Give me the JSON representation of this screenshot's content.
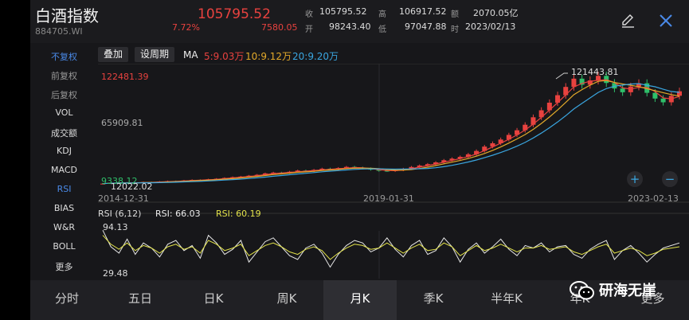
{
  "header": {
    "name": "白酒指数",
    "code": "884705.WI",
    "price": "105795.52",
    "pct": "7.72%",
    "change": "7580.05",
    "quotes": [
      {
        "label": "收",
        "value": "105795.52"
      },
      {
        "label": "高",
        "value": "106917.52"
      },
      {
        "label": "额",
        "value": "2070.05亿"
      },
      {
        "label": "开",
        "value": "98243.40"
      },
      {
        "label": "低",
        "value": "97047.88"
      },
      {
        "label": "时",
        "value": "2023/02/13"
      }
    ]
  },
  "sidebar": {
    "items": [
      "不复权",
      "前复权",
      "后复权",
      "VOL",
      "成交额",
      "KDJ",
      "MACD",
      "RSI",
      "BIAS",
      "W&R",
      "BOLL",
      "更多"
    ]
  },
  "toolbar": {
    "overlay": "叠加",
    "period": "设周期",
    "ma_label": "MA",
    "ma5": "5:9.03万",
    "ma10": "10:9.12万",
    "ma20": "20:9.20万"
  },
  "kline": {
    "high_label": "122481.39",
    "mid_label": "65909.81",
    "low_label": "9338.12",
    "min_label": "12022.02",
    "peak_label": "121443.81",
    "date_start": "2014-12-31",
    "date_mid": "2019-01-31",
    "date_end": "2023-02-13",
    "zoom_in": "+",
    "zoom_out": "−"
  },
  "rsi": {
    "title": "RSI (6,12)",
    "r1": "RSI: 66.03",
    "r2": "RSI: 60.19",
    "top": "94.13",
    "bottom": "29.48"
  },
  "tabs": [
    "分时",
    "五日",
    "日K",
    "周K",
    "月K",
    "季K",
    "半年K",
    "年K",
    "更多"
  ],
  "selected_tab": "月K",
  "watermark": "研海无崖",
  "colors": {
    "up": "#e8423f",
    "down": "#2fbf6a",
    "ma5": "#e8423f",
    "ma10": "#e3a92a",
    "ma20": "#3aa6e0",
    "accent": "#4a8ae8"
  },
  "chart_data": {
    "type": "candlestick",
    "title": "",
    "ylim": [
      9338.12,
      122481.39
    ],
    "close_series": [
      12022,
      12800,
      13200,
      12500,
      13000,
      13600,
      13400,
      14100,
      14600,
      14300,
      15200,
      15800,
      15500,
      16400,
      17000,
      17800,
      18600,
      19200,
      20100,
      21000,
      22400,
      23200,
      22800,
      24100,
      25300,
      24600,
      26000,
      27200,
      26400,
      27800,
      29000,
      28200,
      27400,
      26200,
      25100,
      24800,
      25600,
      27100,
      28900,
      30400,
      31800,
      33600,
      35800,
      37400,
      39200,
      41800,
      45200,
      49600,
      53000,
      56800,
      61500,
      66200,
      71800,
      79400,
      86500,
      94200,
      101800,
      110200,
      118600,
      112400,
      116800,
      121443,
      114200,
      108600,
      104800,
      110600,
      113900,
      104200,
      98400,
      94600,
      101200,
      105795
    ],
    "rsi6": [
      86,
      60,
      50,
      72,
      48,
      66,
      58,
      44,
      64,
      70,
      54,
      62,
      42,
      78,
      66,
      48,
      56,
      70,
      36,
      52,
      68,
      74,
      60,
      46,
      40,
      58,
      64,
      50,
      28,
      48,
      62,
      70,
      66,
      52,
      58,
      74,
      56,
      44,
      62,
      70,
      48,
      54,
      74,
      60,
      36,
      56,
      66,
      50,
      60,
      72,
      56,
      46,
      62,
      58,
      66,
      52,
      60,
      62,
      48,
      42,
      56,
      64,
      70,
      40,
      54,
      62,
      50,
      36,
      48,
      58,
      62,
      66
    ],
    "rsi12": [
      78,
      64,
      56,
      66,
      54,
      62,
      58,
      50,
      60,
      64,
      56,
      60,
      50,
      70,
      64,
      54,
      58,
      64,
      46,
      54,
      62,
      66,
      60,
      52,
      48,
      56,
      60,
      54,
      40,
      50,
      58,
      64,
      62,
      56,
      58,
      66,
      58,
      50,
      58,
      64,
      54,
      56,
      66,
      60,
      46,
      54,
      62,
      54,
      58,
      64,
      58,
      52,
      58,
      58,
      62,
      56,
      58,
      60,
      52,
      48,
      54,
      60,
      64,
      50,
      54,
      58,
      54,
      46,
      50,
      56,
      58,
      60
    ]
  }
}
